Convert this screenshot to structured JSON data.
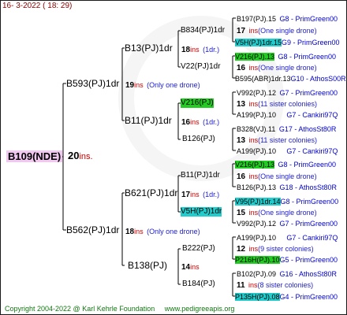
{
  "date": "16- 3-2022 ( 18: 29)",
  "root": {
    "name": "B109(NDE)",
    "number": "20",
    "ins": "ins."
  },
  "gen1": [
    {
      "name": "B593(PJ)1dr",
      "number": "19",
      "ins": "ins",
      "note": "(Only one drone)"
    },
    {
      "name": "B562(PJ)1dr",
      "number": "18",
      "ins": "ins",
      "note": "(Only one drone)"
    }
  ],
  "gen2": [
    {
      "name": "B13(PJ)1dr",
      "number": "18",
      "ins": "ins",
      "note": "(1dr.)"
    },
    {
      "name": "B11(PJ)1dr",
      "number": "16",
      "ins": "ins",
      "note": "(1dr.)"
    },
    {
      "name": "B621(PJ)1dr",
      "number": "17",
      "ins": "ins",
      "note": "(1dr.)"
    },
    {
      "name": "B138(PJ)",
      "number": "14",
      "ins": "ins",
      "note": ""
    }
  ],
  "gen3": [
    {
      "name": "B834(PJ)1dr",
      "number": "17",
      "ins": "ins",
      "note": "(One single drone)"
    },
    {
      "name": "V22(PJ)1dr",
      "number": "16",
      "ins": "ins",
      "note": "(One single drone)"
    },
    {
      "name": "V216(PJ)",
      "number": "13",
      "ins": "ins",
      "note": "(11 sister colonies)"
    },
    {
      "name": "B126(PJ)",
      "number": "13",
      "ins": "ins",
      "note": "(11 sister colonies)"
    },
    {
      "name": "B11(PJ)1dr",
      "number": "16",
      "ins": "ins",
      "note": "(One single drone)"
    },
    {
      "name": "V5H(PJ)1dr",
      "number": "15",
      "ins": "ins",
      "note": "(One single drone)"
    },
    {
      "name": "B222(PJ)",
      "number": "12",
      "ins": "ins",
      "note": "(9 sister colonies)"
    },
    {
      "name": "B184(PJ)",
      "number": "11",
      "ins": "ins",
      "note": "(8 sister colonies)"
    }
  ],
  "gen4": [
    {
      "name": "B197(PJ).15",
      "group": "G8 - PrimGreen00"
    },
    {
      "name": "V5H(PJ)1dr.15",
      "group": "G9 - PrimGreen00"
    },
    {
      "name": "V216(PJ).13",
      "group": "G8 - PrimGreen00"
    },
    {
      "name": "B595(ABR)1dr.13",
      "group": "G10 - AthosS00R"
    },
    {
      "name": "V992(PJ).12",
      "group": "G7 - PrimGreen00"
    },
    {
      "name": "A199(PJ).10",
      "group": "G7 - Cankiri97Q"
    },
    {
      "name": "B328(VJ).11",
      "group": "G17 - AthosSt80R"
    },
    {
      "name": "A199(PJ).10",
      "group": "G7 - Cankiri97Q"
    },
    {
      "name": "V216(PJ).13",
      "group": "G8 - PrimGreen00"
    },
    {
      "name": "B126(PJ).13",
      "group": "G18 - AthosSt80R"
    },
    {
      "name": "V95(PJ)1dr.14",
      "group": "G8 - PrimGreen00"
    },
    {
      "name": "V992(PJ).12",
      "group": "G7 - PrimGreen00"
    },
    {
      "name": "A199(PJ).10",
      "group": "G7 - Cankiri97Q"
    },
    {
      "name": "P216H(PJ).10",
      "group": "G5 - PrimGreen00"
    },
    {
      "name": "B102(PJ).09",
      "group": "G16 - AthosSt80R"
    },
    {
      "name": "P135H(PJ).08",
      "group": "G4 - PrimGreen00"
    }
  ],
  "footer": {
    "copyright": "Copyright 2004-2022 @ Karl Kehrle Foundation",
    "url": "www.pedigreeapis.org"
  },
  "colors": {
    "ins": "#cc0000",
    "group": "#0000cc",
    "highlight_green": "#22cc22",
    "highlight_cyan": "#22cccc",
    "root_bg": "#f0c8f0",
    "footer": "#117711"
  }
}
